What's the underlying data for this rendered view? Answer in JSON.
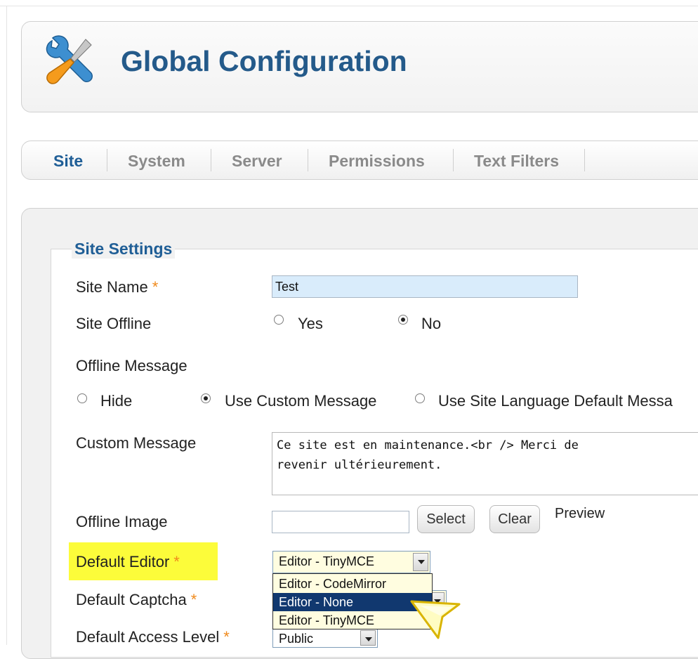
{
  "header": {
    "title": "Global Configuration",
    "icon": "tools-icon"
  },
  "tabs": [
    {
      "label": "Site",
      "active": true
    },
    {
      "label": "System",
      "active": false
    },
    {
      "label": "Server",
      "active": false
    },
    {
      "label": "Permissions",
      "active": false
    },
    {
      "label": "Text Filters",
      "active": false
    }
  ],
  "site_settings": {
    "legend": "Site Settings",
    "required_mark": "*",
    "site_name": {
      "label": "Site Name",
      "value": "Test"
    },
    "site_offline": {
      "label": "Site Offline",
      "yes": "Yes",
      "no": "No",
      "selected": "No"
    },
    "offline_message": {
      "label": "Offline Message",
      "options": [
        "Hide",
        "Use Custom Message",
        "Use Site Language Default Messa"
      ],
      "selected": "Use Custom Message"
    },
    "custom_message": {
      "label": "Custom Message",
      "value": "Ce site est en maintenance.<br /> Merci de\nrevenir ultérieurement."
    },
    "offline_image": {
      "label": "Offline Image",
      "select": "Select",
      "clear": "Clear",
      "preview": "Preview"
    },
    "default_editor": {
      "label": "Default Editor",
      "value": "Editor - TinyMCE",
      "options": [
        "Editor - CodeMirror",
        "Editor - None",
        "Editor - TinyMCE"
      ],
      "highlighted_option": "Editor - None"
    },
    "default_captcha": {
      "label": "Default Captcha"
    },
    "default_access_level": {
      "label": "Default Access Level",
      "value": "Public"
    }
  },
  "colors": {
    "title_blue": "#245a8a",
    "tab_active": "#1f5e96",
    "required_star": "#f08a1c",
    "highlight_yellow": "#fcfc3a",
    "dropdown_selected": "#11386f"
  }
}
